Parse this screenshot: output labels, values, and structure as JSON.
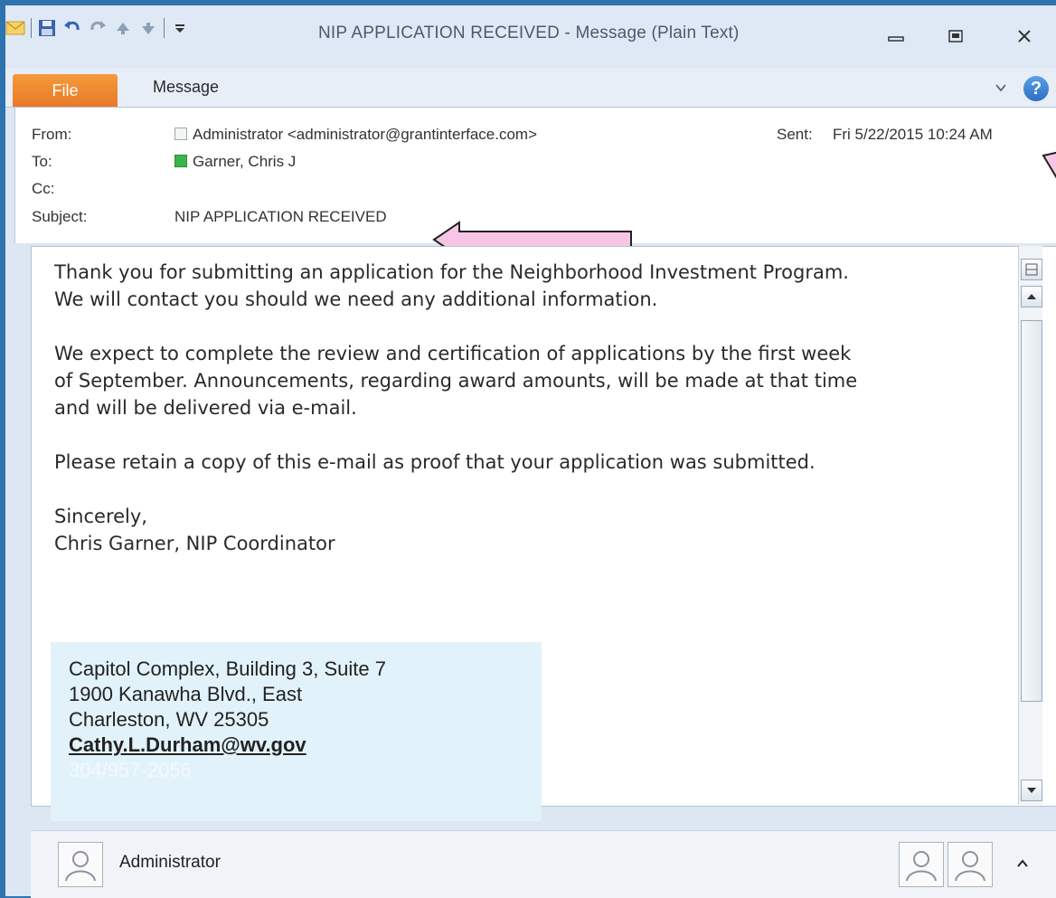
{
  "window": {
    "title": "NIP APPLICATION RECEIVED  -  Message (Plain Text)",
    "qat_icons": [
      "email-icon",
      "save-icon",
      "undo-icon",
      "redo-icon",
      "up-arrow-icon",
      "down-arrow-icon",
      "customize-icon"
    ]
  },
  "ribbon": {
    "file_tab": "File",
    "message_tab": "Message"
  },
  "header": {
    "from_label": "From:",
    "from_value": "Administrator <administrator@grantinterface.com>",
    "sent_label": "Sent:",
    "sent_value": "Fri 5/22/2015 10:24 AM",
    "to_label": "To:",
    "to_value": "Garner, Chris J",
    "cc_label": "Cc:",
    "subject_label": "Subject:",
    "subject_value": "NIP APPLICATION RECEIVED"
  },
  "body": {
    "p1_l1": "Thank you for submitting an application for the Neighborhood Investment Program.",
    "p1_l2": "We will contact you should we need any additional information.",
    "p2_l1": "We expect to complete the review and certification of applications by the first week",
    "p2_l2": "of September.  Announcements, regarding award amounts, will be made at that time",
    "p2_l3": "and will be delivered via e-mail.",
    "p3": "Please retain a copy of this e-mail as proof that your application was submitted.",
    "sign1": "Sincerely,",
    "sign2": "Chris Garner, NIP Coordinator"
  },
  "overlay": {
    "line1": "Capitol Complex, Building 3, Suite 7",
    "line2": "1900 Kanawha Blvd., East",
    "line3": "Charleston, WV 25305",
    "email": "Cathy.L.Durham@wv.gov",
    "phone": "304/957-2056"
  },
  "footer": {
    "sender_name": "Administrator"
  },
  "colors": {
    "desktop": "#2e73b0",
    "file_tab": "#e8792a",
    "arrow_fill": "#f7c6e6",
    "overlay_bg": "#e2f2fa"
  }
}
